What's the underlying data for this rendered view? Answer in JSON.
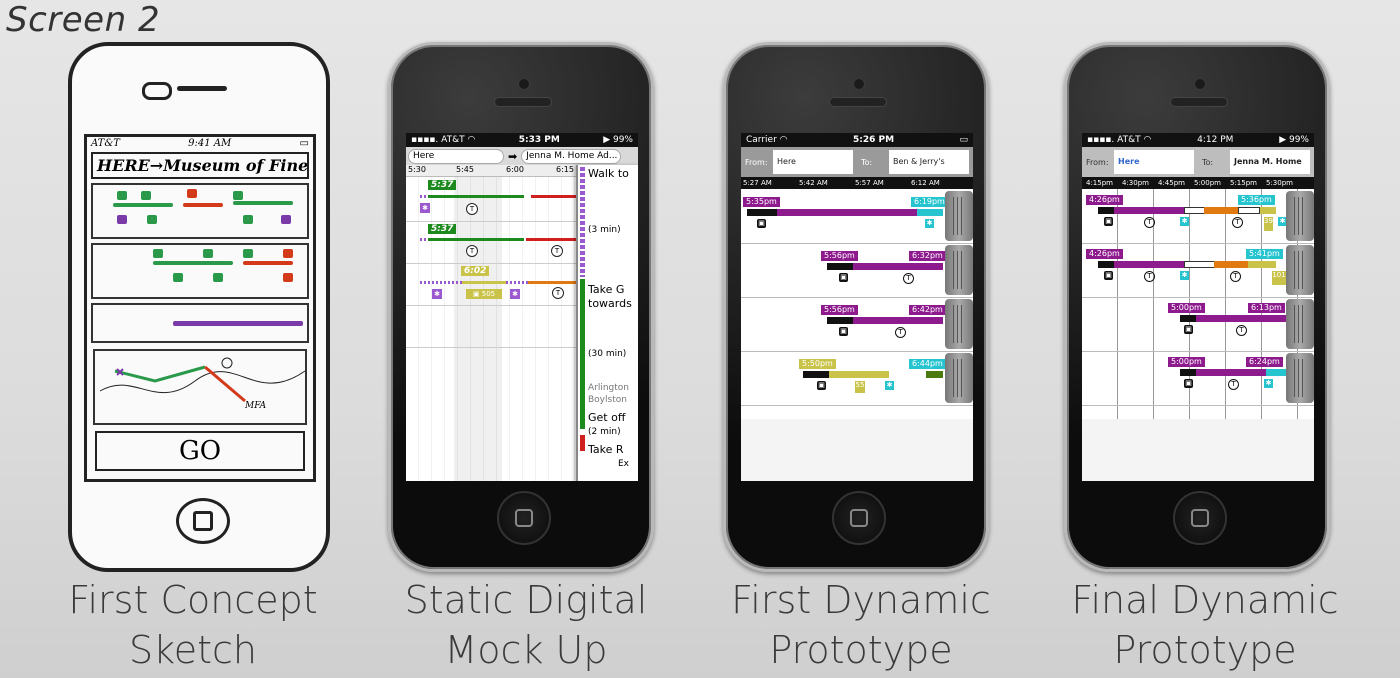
{
  "headline": "Screen 2",
  "captions": [
    {
      "line1": "First Concept",
      "line2": "Sketch"
    },
    {
      "line1": "Static Digital",
      "line2": "Mock Up"
    },
    {
      "line1": "First Dynamic",
      "line2": "Prototype"
    },
    {
      "line1": "Final Dynamic",
      "line2": "Prototype"
    }
  ],
  "sketch": {
    "carrier": "AT&T",
    "time": "9:41 AM",
    "title": "HERE→Museum of Fine Arts",
    "map_label": "MFA",
    "go": "GO"
  },
  "mockup": {
    "carrier": "AT&T",
    "time": "5:33 PM",
    "battery": "99%",
    "from": "Here",
    "to": "Jenna M. Home Ad...",
    "ticks": [
      "5:30",
      "5:45",
      "6:00",
      "6:15"
    ],
    "row_labels": [
      "5:37",
      "5:37",
      "6:02"
    ],
    "bus_number": "505",
    "detail": [
      "Walk to",
      "(3 min)",
      "Take G",
      "towards",
      "(30 min)",
      "Arlington",
      "Boylston",
      "Get off",
      "(2 min)",
      "Take R",
      "Ex"
    ]
  },
  "first_dynamic": {
    "carrier": "Carrier",
    "time": "5:26 PM",
    "from_label": "From:",
    "from": "Here",
    "to_label": "To:",
    "to": "Ben & Jerry's",
    "ticks": [
      "5:27 AM",
      "5:42 AM",
      "5:57 AM",
      "6:12 AM"
    ],
    "rows": [
      {
        "start": "5:35pm",
        "end": "6:19pm"
      },
      {
        "start": "5:56pm",
        "end": "6:32pm"
      },
      {
        "start": "5:56pm",
        "end": "6:42pm"
      },
      {
        "start": "5:50pm",
        "end": "6:44pm"
      }
    ],
    "bus_number": "55"
  },
  "final_dynamic": {
    "carrier": "AT&T",
    "time": "4:12 PM",
    "battery": "99%",
    "from_label": "From:",
    "from": "Here",
    "to_label": "To:",
    "to": "Jenna M. Home",
    "ticks": [
      "4:15pm",
      "4:30pm",
      "4:45pm",
      "5:00pm",
      "5:15pm",
      "5:30pm"
    ],
    "rows": [
      {
        "start": "4:26pm",
        "end": "5:36pm"
      },
      {
        "start": "4:26pm",
        "end": "5:41pm"
      },
      {
        "start": "5:00pm",
        "end": "6:13pm"
      },
      {
        "start": "5:00pm",
        "end": "6:24pm"
      }
    ],
    "bus_numbers": [
      "39",
      "101"
    ]
  },
  "colors": {
    "purple": "#8e1b8e",
    "teal": "#25c4cf",
    "green": "#1d8a1d",
    "red": "#d01f1f",
    "orange": "#e07a10",
    "yellow": "#c9c34a"
  }
}
